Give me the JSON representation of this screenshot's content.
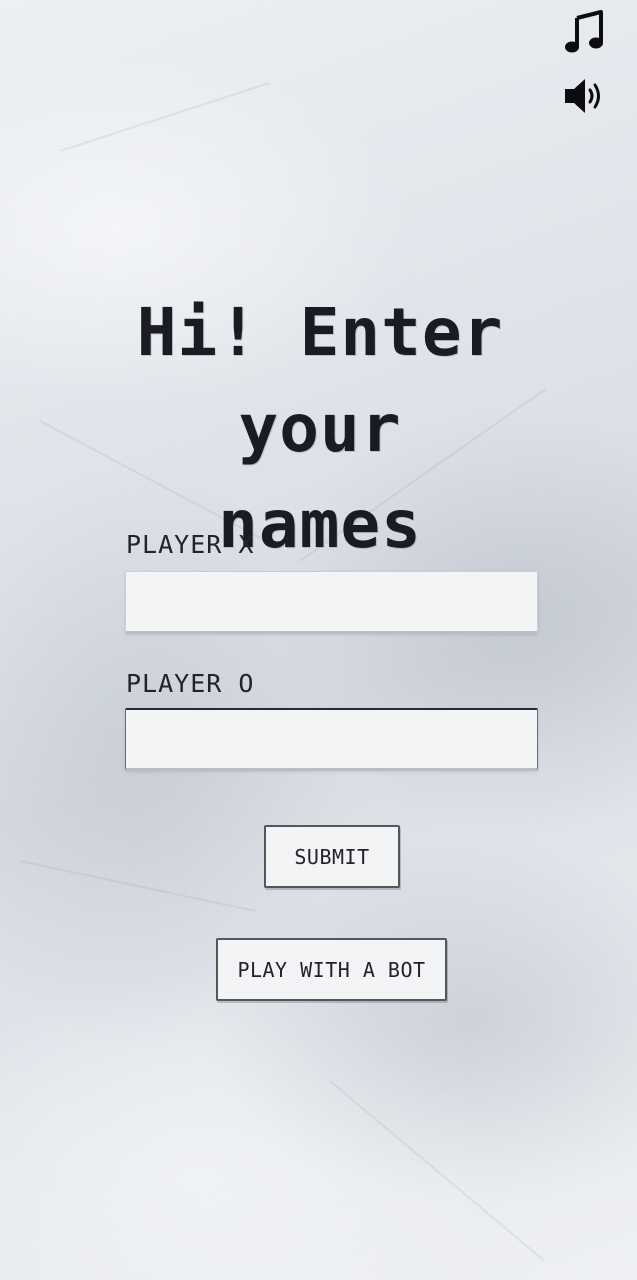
{
  "header": {
    "music_icon": "music-note-icon",
    "sound_icon": "speaker-volume-icon"
  },
  "title": {
    "line1": "Hi! Enter your",
    "line2": "names"
  },
  "form": {
    "player_x_label": "PLAYER X",
    "player_x_value": "",
    "player_o_label": "PLAYER O",
    "player_o_value": ""
  },
  "buttons": {
    "submit_label": "SUBMIT",
    "bot_label": "PLAY WITH A BOT"
  },
  "colors": {
    "text": "#1d1d24",
    "background": "#e2e5ea",
    "input_background": "#f3f4f6"
  }
}
